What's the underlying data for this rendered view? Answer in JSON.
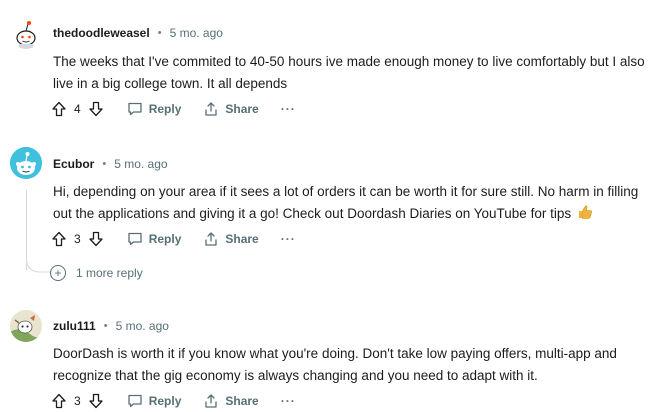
{
  "comments": [
    {
      "author": "thedoodleweasel",
      "separator": "•",
      "age": "5 mo. ago",
      "text": "The weeks that I've commited to 40-50 hours ive made enough money to live comfortably but I also live in a big college town. It all depends",
      "votes": "4",
      "reply_label": "Reply",
      "share_label": "Share",
      "more_label": "···"
    },
    {
      "author": "Ecubor",
      "separator": "•",
      "age": "5 mo. ago",
      "text": "Hi, depending on your area if it sees a lot of orders it can be worth it for sure still. No harm in filling out the applications and giving it a go! Check out Doordash Diaries on YouTube for tips",
      "votes": "3",
      "reply_label": "Reply",
      "share_label": "Share",
      "more_label": "···"
    },
    {
      "author": "zulu111",
      "separator": "•",
      "age": "5 mo. ago",
      "text": "DoorDash is worth it if you know what you're doing. Don't take low paying offers, multi-app and recognize that the gig economy is always changing and you need to adapt with it.",
      "votes": "3",
      "reply_label": "Reply",
      "share_label": "Share",
      "more_label": "···"
    }
  ],
  "more_replies": {
    "icon": "plus-circle-icon",
    "label": "1 more reply"
  },
  "emoji": "thumbs-up-icon",
  "colors": {
    "meta_gray": "#576f76",
    "avatar_ecubor": "#3fc0dc",
    "thumb": "#f2b33d"
  }
}
